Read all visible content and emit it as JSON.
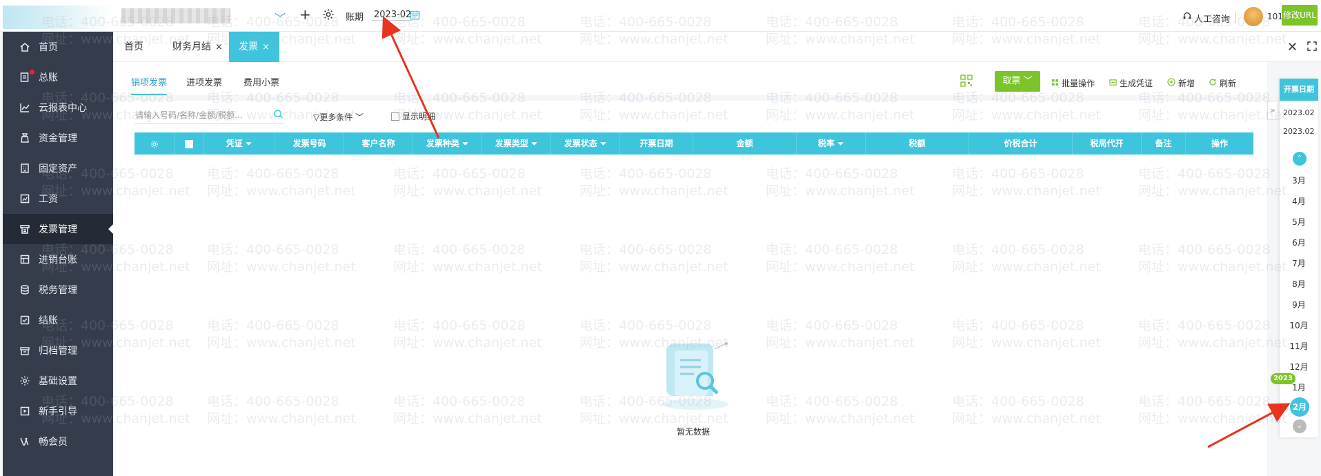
{
  "header": {
    "add_label": "+",
    "period_label": "账期",
    "period_value": "2023-02",
    "consult_label": "人工咨询",
    "user_id": "101",
    "modify_url_label": "修改URL"
  },
  "sidebar": {
    "items": [
      {
        "label": "首页",
        "icon": "home-icon"
      },
      {
        "label": "总账",
        "icon": "ledger-icon"
      },
      {
        "label": "云报表中心",
        "icon": "chart-icon"
      },
      {
        "label": "资金管理",
        "icon": "money-icon"
      },
      {
        "label": "固定资产",
        "icon": "building-icon"
      },
      {
        "label": "工资",
        "icon": "salary-icon"
      },
      {
        "label": "发票管理",
        "icon": "invoice-icon"
      },
      {
        "label": "进销台账",
        "icon": "stock-icon"
      },
      {
        "label": "税务管理",
        "icon": "tax-icon"
      },
      {
        "label": "结账",
        "icon": "close-books-icon"
      },
      {
        "label": "归档管理",
        "icon": "archive-icon"
      },
      {
        "label": "基础设置",
        "icon": "gear-icon"
      },
      {
        "label": "新手引导",
        "icon": "guide-icon"
      },
      {
        "label": "畅会员",
        "icon": "vip-icon"
      }
    ],
    "active": "发票管理"
  },
  "tabs": [
    {
      "label": "首页"
    },
    {
      "label": "财务月结",
      "close": "×"
    },
    {
      "label": "发票",
      "close": "×"
    }
  ],
  "subtabs": [
    {
      "label": "销项发票"
    },
    {
      "label": "进项发票"
    },
    {
      "label": "费用小票"
    }
  ],
  "toolbar": {
    "fetch_label": "取票",
    "batch_label": "批量操作",
    "voucher_label": "生成凭证",
    "new_label": "新增",
    "refresh_label": "刷新"
  },
  "filters": {
    "search_placeholder": "请输入号码/名称/金额/税额...",
    "more_label": "更多条件",
    "show_detail_label": "显示明细"
  },
  "table": {
    "columns": [
      "凭证",
      "发票号码",
      "客户名称",
      "发票种类",
      "发票类型",
      "发票状态",
      "开票日期",
      "金额",
      "税率",
      "税额",
      "价税合计",
      "税局代开",
      "备注",
      "操作"
    ],
    "empty_text": "暂无数据"
  },
  "date_panel": {
    "header": "开票日期",
    "range_start": "2023.02",
    "range_end": "2023.02",
    "months": [
      "3月",
      "4月",
      "5月",
      "6月",
      "7月",
      "8月",
      "9月",
      "10月",
      "11月",
      "12月",
      "1月"
    ],
    "year_badge": "2023",
    "selected_month": "2月"
  },
  "watermark": {
    "phone": "电话：400-665-0028",
    "site": "网址：www.chanjet.net"
  },
  "colors": {
    "accent": "#3ec4dc",
    "green": "#7dc42a",
    "sidebar": "#353d4d",
    "arrow": "#e8331f"
  }
}
